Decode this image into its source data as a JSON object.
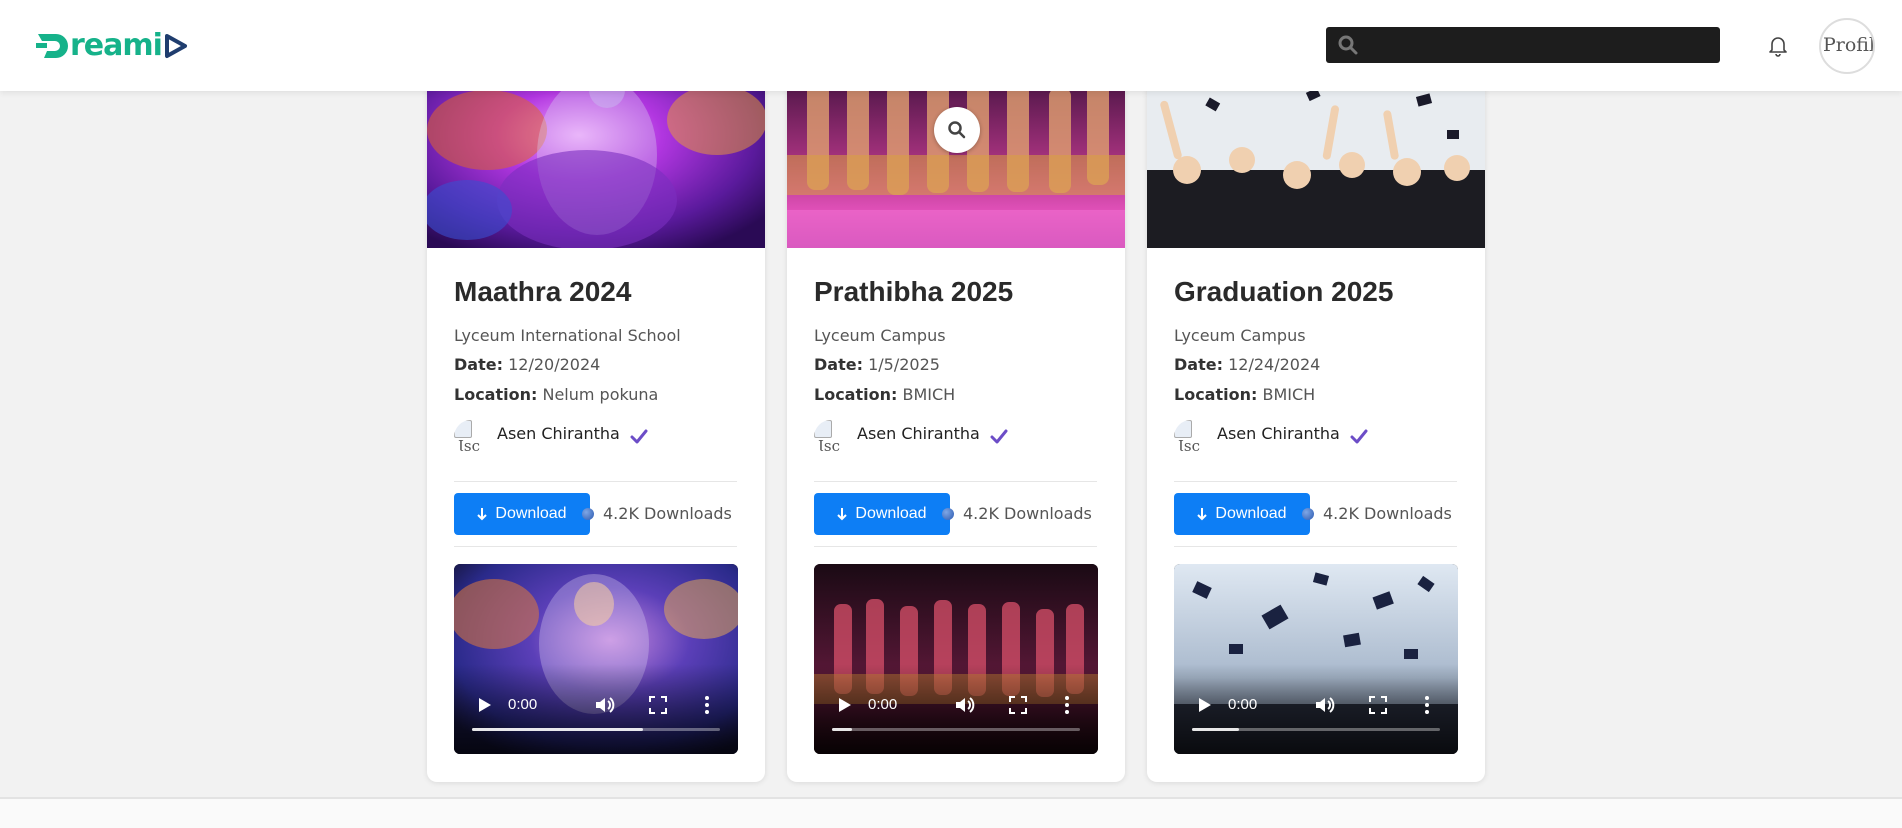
{
  "header": {
    "logo_text": "reami",
    "search": {
      "placeholder": "",
      "value": ""
    },
    "profile_alt": "Profile"
  },
  "colors": {
    "brand_green": "#16b28a",
    "brand_navy": "#1f3d6e",
    "primary_button": "#0d7ef5",
    "verified": "#6c4dc7"
  },
  "icons": [
    "search-icon",
    "bell-icon",
    "zoom-icon",
    "download-icon",
    "verified-icon",
    "play-icon",
    "volume-icon",
    "fullscreen-icon",
    "more-icon"
  ],
  "cards": [
    {
      "title": "Maathra 2024",
      "organization": "Lyceum International School",
      "date_label": "Date:",
      "date": "12/20/2024",
      "location_label": "Location:",
      "location": "Nelum pokuna",
      "author_img_alt": "Isc",
      "author": "Asen Chirantha",
      "download_label": "Download",
      "downloads": "4.2K Downloads",
      "video_time": "0:00",
      "video_progress": 0.69
    },
    {
      "title": "Prathibha 2025",
      "organization": "Lyceum Campus",
      "date_label": "Date:",
      "date": "1/5/2025",
      "location_label": "Location:",
      "location": "BMICH",
      "author_img_alt": "Isc",
      "author": "Asen Chirantha",
      "download_label": "Download",
      "downloads": "4.2K Downloads",
      "video_time": "0:00",
      "video_progress": 0.08
    },
    {
      "title": "Graduation 2025",
      "organization": "Lyceum Campus",
      "date_label": "Date:",
      "date": "12/24/2024",
      "location_label": "Location:",
      "location": "BMICH",
      "author_img_alt": "Isc",
      "author": "Asen Chirantha",
      "download_label": "Download",
      "downloads": "4.2K Downloads",
      "video_time": "0:00",
      "video_progress": 0.19
    }
  ]
}
